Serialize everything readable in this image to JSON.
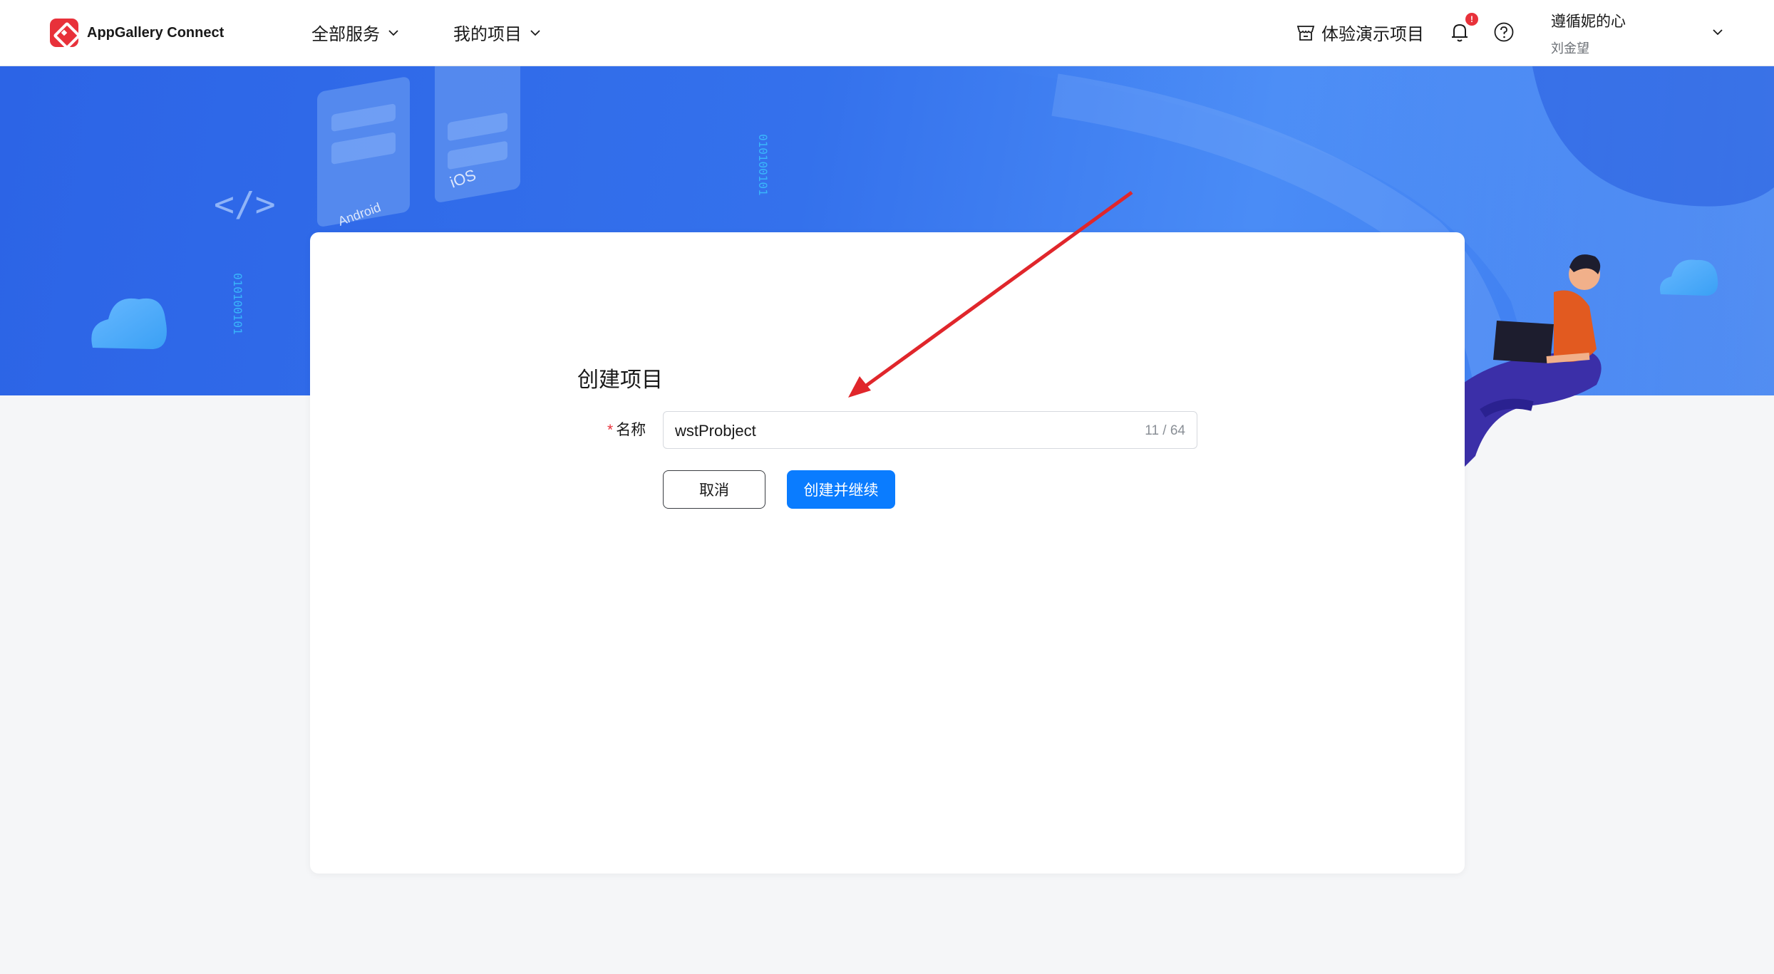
{
  "header": {
    "logo_text": "AppGallery Connect",
    "nav": {
      "services": "全部服务",
      "projects": "我的项目"
    },
    "demo_label": "体验演示项目",
    "notification_count": "!",
    "user": {
      "name": "遵循妮的心",
      "sub": "刘金望"
    }
  },
  "banner": {
    "android_label": "Android",
    "ios_label": "iOS",
    "code_glyph": "</>",
    "binary_text": "010100101"
  },
  "form": {
    "title": "创建项目",
    "name_label": "名称",
    "required_mark": "*",
    "name_value": "wstProbject",
    "char_count": "11 / 64",
    "cancel_label": "取消",
    "create_label": "创建并继续"
  },
  "colors": {
    "primary": "#0a7cff",
    "brand_red": "#e8313a",
    "banner_blue": "#2c64e6",
    "arrow_red": "#e0262b"
  },
  "icons": {
    "logo": "appgallery-logo-icon",
    "demo": "demo-store-icon",
    "bell": "bell-icon",
    "help": "help-icon"
  }
}
